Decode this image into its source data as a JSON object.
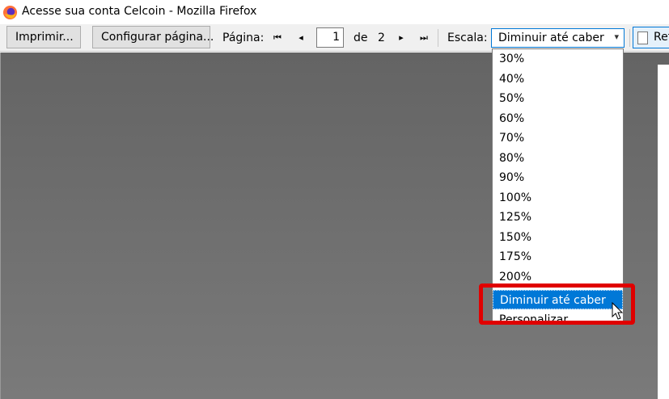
{
  "window": {
    "title": "Acesse sua conta Celcoin - Mozilla Firefox",
    "app_icon": "firefox-icon"
  },
  "toolbar": {
    "print_label": "Imprimir...",
    "page_setup_label": "Configurar página...",
    "page_label": "Página:",
    "first_icon": "⏮",
    "prev_icon": "◂",
    "page_value": "1",
    "of_label": "de",
    "total_pages": "2",
    "next_icon": "▸",
    "last_icon": "⏭",
    "scale_label": "Escala:",
    "scale_value": "Diminuir até caber",
    "ref_label": "Ref"
  },
  "scale_options": [
    "30%",
    "40%",
    "50%",
    "60%",
    "70%",
    "80%",
    "90%",
    "100%",
    "125%",
    "150%",
    "175%",
    "200%",
    "Diminuir até caber",
    "Personalizar..."
  ],
  "selected_option": "Diminuir até caber",
  "colors": {
    "highlight": "#e00000",
    "selection": "#0078d7"
  }
}
